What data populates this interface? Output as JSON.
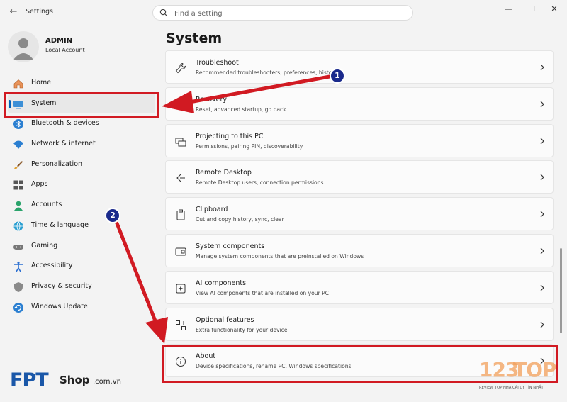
{
  "app": {
    "title": "Settings",
    "back_label": "←"
  },
  "search": {
    "placeholder": "Find a setting"
  },
  "window_controls": {
    "minimize": "—",
    "maximize": "☐",
    "close": "✕"
  },
  "account": {
    "name": "ADMIN",
    "type": "Local Account"
  },
  "nav": [
    {
      "label": "Home",
      "icon": "home-icon",
      "selected": false
    },
    {
      "label": "System",
      "icon": "monitor-icon",
      "selected": true
    },
    {
      "label": "Bluetooth & devices",
      "icon": "bluetooth-icon",
      "selected": false
    },
    {
      "label": "Network & internet",
      "icon": "wifi-icon",
      "selected": false
    },
    {
      "label": "Personalization",
      "icon": "brush-icon",
      "selected": false
    },
    {
      "label": "Apps",
      "icon": "apps-icon",
      "selected": false
    },
    {
      "label": "Accounts",
      "icon": "person-icon",
      "selected": false
    },
    {
      "label": "Time & language",
      "icon": "globe-icon",
      "selected": false
    },
    {
      "label": "Gaming",
      "icon": "gamepad-icon",
      "selected": false
    },
    {
      "label": "Accessibility",
      "icon": "accessibility-icon",
      "selected": false
    },
    {
      "label": "Privacy & security",
      "icon": "shield-icon",
      "selected": false
    },
    {
      "label": "Windows Update",
      "icon": "update-icon",
      "selected": false
    }
  ],
  "page": {
    "title": "System"
  },
  "cards": [
    {
      "title": "Troubleshoot",
      "subtitle": "Recommended troubleshooters, preferences, history",
      "icon": "wrench-icon"
    },
    {
      "title": "Recovery",
      "subtitle": "Reset, advanced startup, go back",
      "icon": "recovery-icon"
    },
    {
      "title": "Projecting to this PC",
      "subtitle": "Permissions, pairing PIN, discoverability",
      "icon": "projector-icon"
    },
    {
      "title": "Remote Desktop",
      "subtitle": "Remote Desktop users, connection permissions",
      "icon": "remote-desktop-icon"
    },
    {
      "title": "Clipboard",
      "subtitle": "Cut and copy history, sync, clear",
      "icon": "clipboard-icon"
    },
    {
      "title": "System components",
      "subtitle": "Manage system components that are preinstalled on Windows",
      "icon": "components-icon"
    },
    {
      "title": "AI components",
      "subtitle": "View AI components that are installed on your PC",
      "icon": "ai-icon"
    },
    {
      "title": "Optional features",
      "subtitle": "Extra functionality for your device",
      "icon": "optional-features-icon"
    },
    {
      "title": "About",
      "subtitle": "Device specifications, rename PC, Windows specifications",
      "icon": "info-icon"
    }
  ],
  "annotations": {
    "badge_1": "1",
    "badge_2": "2",
    "color": "#d11a22",
    "badge_color": "#1a2a8c"
  },
  "watermarks": {
    "fpt": "FPT",
    "shop": "Shop",
    "shop_domain": ".com.vn",
    "top_num": "123",
    "top_word": "TOP",
    "top_tag": "REVIEW TOP NHÀ CÁI UY TÍN NHẤT"
  },
  "colors": {
    "accent": "#005fb8",
    "background": "#f3f3f3",
    "card": "#fbfbfb"
  }
}
